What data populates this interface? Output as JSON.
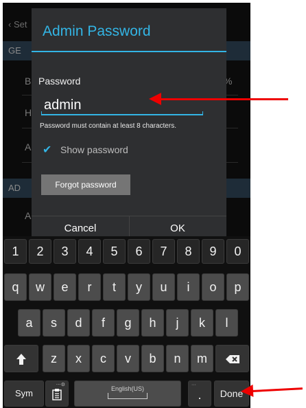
{
  "background": {
    "back_label": "‹ Set",
    "section1": "GE",
    "row1_letter": "B",
    "row1_suffix": "%",
    "row2_letter": "H",
    "row3_letter": "A",
    "section2": "AD",
    "row4_letter": "A"
  },
  "dialog": {
    "title": "Admin Password",
    "password_label": "Password",
    "password_value": "admin",
    "hint": "Password must contain at least 8 characters.",
    "show_password_label": "Show password",
    "show_password_checked": true,
    "forgot_button": "Forgot password",
    "cancel_button": "Cancel",
    "ok_button": "OK"
  },
  "keyboard": {
    "number_row": [
      "1",
      "2",
      "3",
      "4",
      "5",
      "6",
      "7",
      "8",
      "9",
      "0"
    ],
    "row1": [
      "q",
      "w",
      "e",
      "r",
      "t",
      "y",
      "u",
      "i",
      "o",
      "p"
    ],
    "row2": [
      "a",
      "s",
      "d",
      "f",
      "g",
      "h",
      "j",
      "k",
      "l"
    ],
    "row3": [
      "z",
      "x",
      "c",
      "v",
      "b",
      "n",
      "m"
    ],
    "sym_key": "Sym",
    "space_label": "English(US)",
    "period_key": ".",
    "period_sub": "···",
    "done_key": "Done"
  },
  "icons": {
    "shift": "shift-icon",
    "backspace": "backspace-icon",
    "clipboard": "clipboard-icon",
    "check": "checkbox-checked-icon"
  },
  "colors": {
    "accent": "#33b5e5",
    "annotation_arrow": "#ee0000"
  }
}
